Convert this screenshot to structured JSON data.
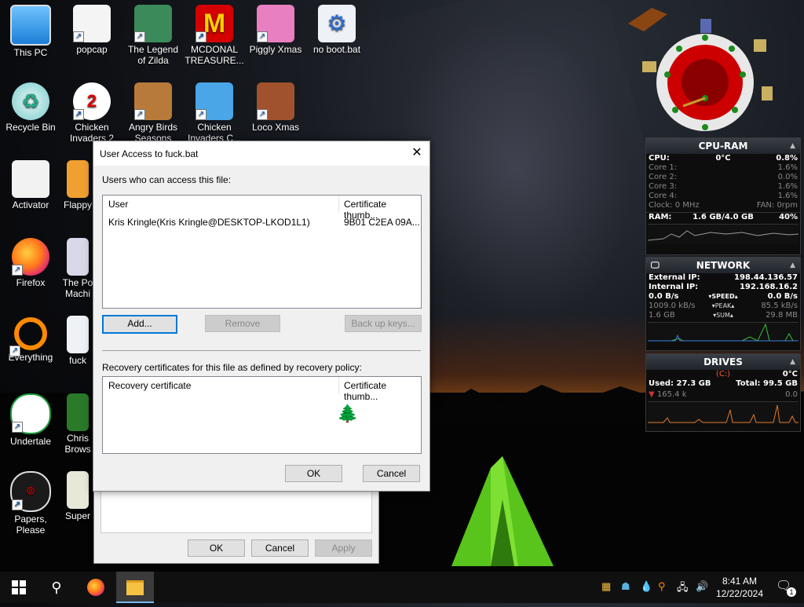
{
  "desktop": {
    "icons": [
      {
        "label": "This PC",
        "name": "this-pc-icon"
      },
      {
        "label": "popcap",
        "name": "popcap-folder-icon"
      },
      {
        "label": "The Legend of Zilda",
        "name": "legend-of-zilda-icon"
      },
      {
        "label": "MCDONAL TREASURE...",
        "name": "mcdonal-treasure-icon"
      },
      {
        "label": "Piggly Xmas",
        "name": "piggly-xmas-icon"
      },
      {
        "label": "no boot.bat",
        "name": "no-boot-bat-icon"
      },
      {
        "label": "Recycle Bin",
        "name": "recycle-bin-icon"
      },
      {
        "label": "Chicken Invaders 2",
        "name": "chicken-invaders-2-icon"
      },
      {
        "label": "Angry Birds Seasons",
        "name": "angry-birds-seasons-icon"
      },
      {
        "label": "Chicken Invaders C...",
        "name": "chicken-invaders-c-icon"
      },
      {
        "label": "Loco Xmas",
        "name": "loco-xmas-icon"
      },
      {
        "label": "Activator",
        "name": "activator-icon"
      },
      {
        "label": "Flappy",
        "name": "flappy-icon"
      },
      {
        "label": "Firefox",
        "name": "firefox-icon"
      },
      {
        "label": "The Po Machi",
        "name": "the-po-machi-icon"
      },
      {
        "label": "Everything",
        "name": "everything-icon"
      },
      {
        "label": "fuck",
        "name": "fuck-bat-icon"
      },
      {
        "label": "Undertale",
        "name": "undertale-icon"
      },
      {
        "label": "Chris Brows",
        "name": "chris-brows-icon"
      },
      {
        "label": "Papers, Please",
        "name": "papers-please-icon"
      },
      {
        "label": "Super",
        "name": "super-icon"
      }
    ]
  },
  "dialog": {
    "title": "User Access to fuck.bat",
    "users_label": "Users who can access this file:",
    "user_col": "User",
    "thumb_col": "Certificate thumb...",
    "user_row": {
      "user": "Kris Kringle(Kris Kringle@DESKTOP-LKOD1L1)",
      "thumb": "9B01 C2EA 09A..."
    },
    "add_label": "Add...",
    "remove_label": "Remove",
    "backup_label": "Back up keys...",
    "recovery_label": "Recovery certificates for this file as defined by recovery policy:",
    "recovery_col": "Recovery certificate",
    "recovery_thumb_col": "Certificate thumb...",
    "ok_label": "OK",
    "cancel_label": "Cancel"
  },
  "back_dialog": {
    "ok_label": "OK",
    "cancel_label": "Cancel",
    "apply_label": "Apply"
  },
  "cpu_ram": {
    "title": "CPU-RAM",
    "cpu_label": "CPU:",
    "cpu_temp": "0°C",
    "cpu_value": "0.8%",
    "cores": [
      {
        "label": "Core 1:",
        "value": "1.6%"
      },
      {
        "label": "Core 2:",
        "value": "0.0%"
      },
      {
        "label": "Core 3:",
        "value": "1.6%"
      },
      {
        "label": "Core 4:",
        "value": "1.6%"
      }
    ],
    "clock": "Clock: 0 MHz",
    "fan": "FAN: 0rpm",
    "ram_label": "RAM:",
    "ram_used": "1.6 GB/4.0 GB",
    "ram_pct": "40%"
  },
  "network": {
    "title": "NETWORK",
    "external_label": "External IP:",
    "external_ip": "198.44.136.57",
    "internal_label": "Internal IP:",
    "internal_ip": "192.168.16.2",
    "speed_down": "0.0 B/s",
    "speed_label": "SPEED",
    "speed_up": "0.0 B/s",
    "peak_down": "1009.0 kB/s",
    "peak_label": "PEAK",
    "peak_up": "85.5 kB/s",
    "sum_down": "1.6 GB",
    "sum_label": "SUM",
    "sum_up": "29.8 MB"
  },
  "drives": {
    "title": "DRIVES",
    "drive": "(C:)",
    "temp": "0°C",
    "used": "Used: 27.3 GB",
    "total": "Total: 99.5 GB",
    "read": "165.4 k",
    "write": "0.0"
  },
  "taskbar": {
    "time": "8:41 AM",
    "date": "12/22/2024",
    "notification_count": "1"
  },
  "colors": {
    "accent": "#0078d7",
    "gadget_bg": "#0d0d0d",
    "graph_green": "#3cbf3c"
  }
}
